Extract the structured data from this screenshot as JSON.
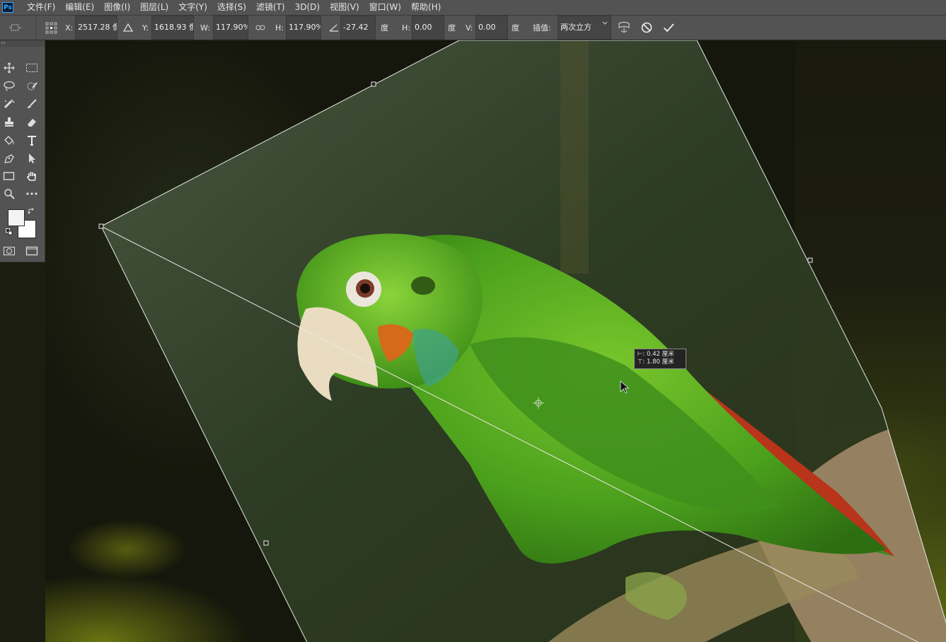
{
  "app": {
    "logo": "Ps"
  },
  "menu": [
    "文件(F)",
    "编辑(E)",
    "图像(I)",
    "图层(L)",
    "文字(Y)",
    "选择(S)",
    "滤镜(T)",
    "3D(D)",
    "视图(V)",
    "窗口(W)",
    "帮助(H)"
  ],
  "options": {
    "x_label": "X:",
    "x_value": "2517.28 像",
    "y_label": "Y:",
    "y_value": "1618.93 像",
    "w_label": "W:",
    "w_value": "117.90%",
    "h_label": "H:",
    "h_value": "117.90%",
    "angle_value": "-27.42",
    "angle_unit": "度",
    "hskew_label": "H:",
    "hskew_value": "0.00",
    "hskew_unit": "度",
    "vskew_label": "V:",
    "vskew_value": "0.00",
    "vskew_unit": "度",
    "interp_label": "插值:",
    "interp_value": "两次立方"
  },
  "tooltip": {
    "line1": "⊢: 0.42 厘米",
    "line2": "⊤: 1.80 厘米"
  },
  "icons": {
    "transform_mode": "transform-icon",
    "reference_point": "reference-point-icon",
    "delta": "delta-icon",
    "link": "link-icon",
    "warp": "warp-icon",
    "cancel": "cancel-icon",
    "commit": "commit-icon"
  },
  "colors": {
    "ui_panel": "#535353",
    "foreground": "#f4f4f4",
    "background": "#ffffff",
    "parrot_green": "#4aa81c"
  }
}
